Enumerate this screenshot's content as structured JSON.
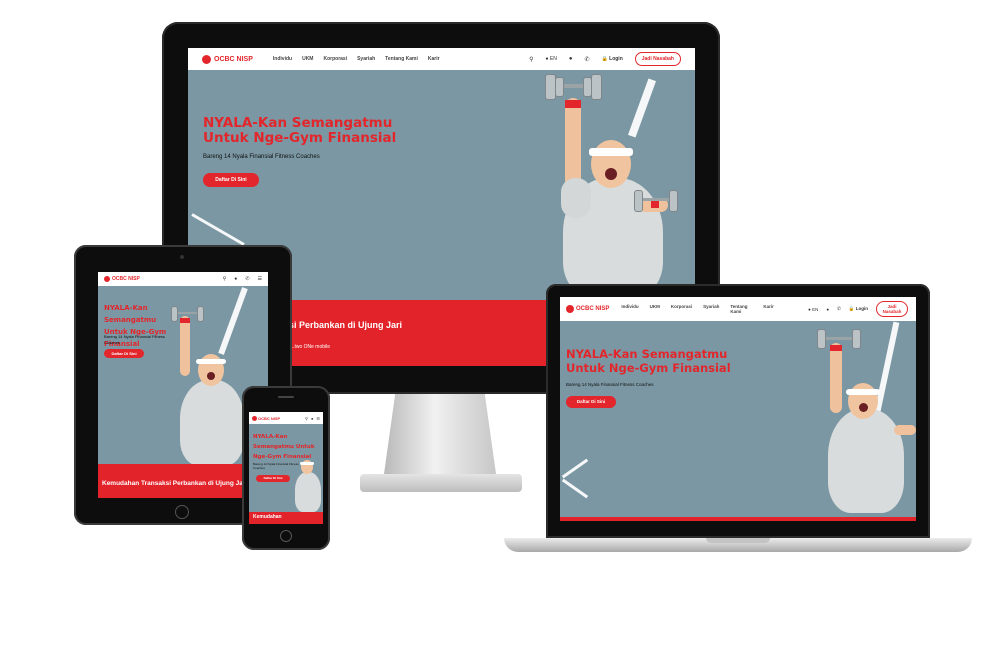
{
  "site": {
    "logo_text": "OCBC NISP",
    "logo_sub": "With You",
    "nav": [
      "Individu",
      "UKM",
      "Korporasi",
      "Syariah",
      "Tentang Kami",
      "Karir"
    ],
    "nav_laptop": [
      "Individu",
      "UKM",
      "Korporasi",
      "Syariah",
      "Tentang Kami",
      "Karir"
    ],
    "lang": "EN",
    "login": "Login",
    "open_account": "Jadi Nasabah",
    "hero_title_line1": "NYALA-Kan Semangatmu",
    "hero_title_line2": "Untuk Nge-Gym Finansial",
    "hero_subtitle": "Bareng 14 Nyala Finansial Fitness Coaches",
    "hero_cta": "Daftar Di Sini",
    "bar_title_desktop": "esi Perbankan di Ujung Jari",
    "bar_sub_desktop": "kses...two ONe mobile",
    "bar_title_tablet": "Kemudahan Transaksi Perbankan di Ujung Jari",
    "bar_title_phone": "Kemudahan",
    "tablet_title": "NYALA-Kan Semangatmu Untuk Nge-Gym Finansial",
    "tablet_subtitle": "Bareng 14 Nyala Finansial Fitness Coaches",
    "phone_title": "NYALA-Kan Semangatmu Untuk Nge-Gym Finansial",
    "phone_subtitle": "Bareng 14 Nyala Finansial Fitness Coaches"
  },
  "colors": {
    "brand_red": "#e3262b",
    "hero_bg": "#7b97a3",
    "device_black": "#0d0d0d"
  },
  "icons": [
    "search-icon",
    "globe-icon",
    "chat-icon",
    "phone-icon",
    "lock-icon",
    "menu-icon"
  ]
}
